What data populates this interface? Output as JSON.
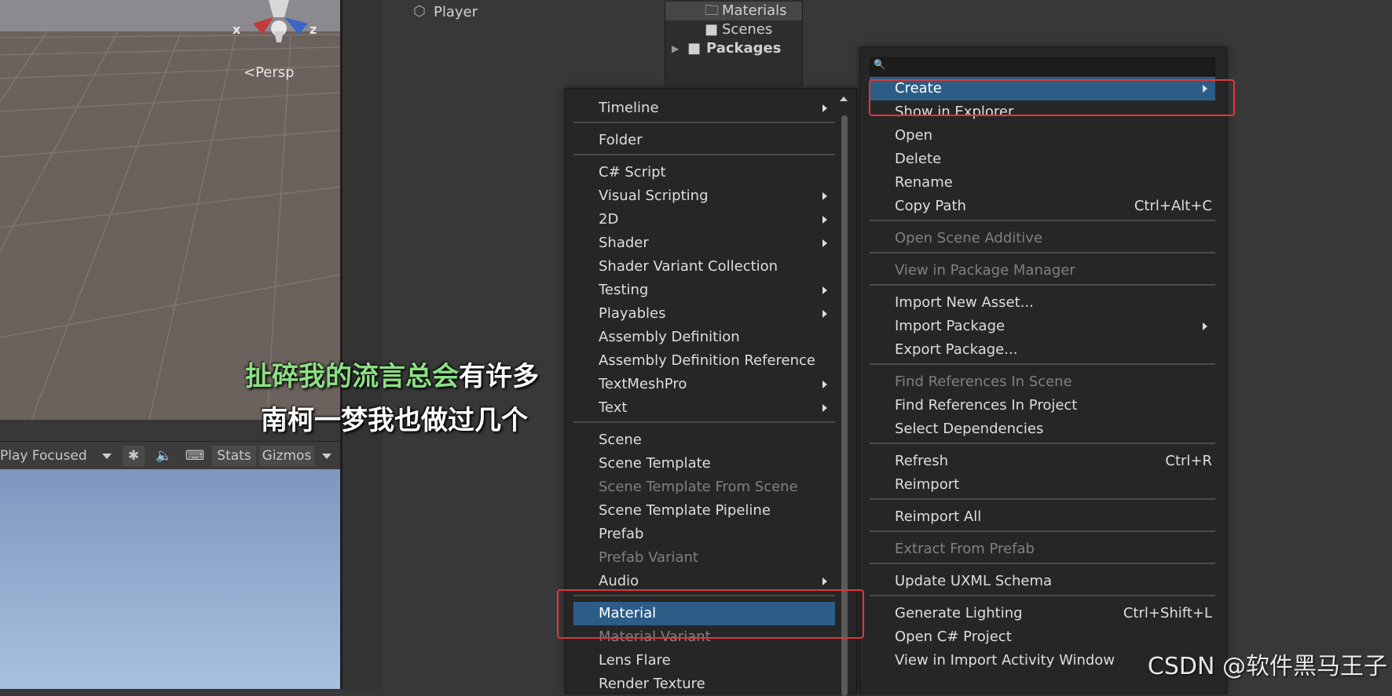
{
  "scene": {
    "axis_x": "x",
    "axis_z": "z",
    "persp_label": "<Persp",
    "hierarchy_item": "Player"
  },
  "game_toolbar": {
    "play_focused": "Play Focused",
    "stats": "Stats",
    "gizmos": "Gizmos"
  },
  "project_tree": {
    "materials": "Materials",
    "scenes": "Scenes",
    "packages": "Packages"
  },
  "create_menu": {
    "items": [
      {
        "label": "Timeline",
        "submenu": true
      },
      {
        "label": "Folder"
      },
      {
        "label": "C# Script"
      },
      {
        "label": "Visual Scripting",
        "submenu": true
      },
      {
        "label": "2D",
        "submenu": true
      },
      {
        "label": "Shader",
        "submenu": true
      },
      {
        "label": "Shader Variant Collection"
      },
      {
        "label": "Testing",
        "submenu": true
      },
      {
        "label": "Playables",
        "submenu": true
      },
      {
        "label": "Assembly Definition"
      },
      {
        "label": "Assembly Definition Reference"
      },
      {
        "label": "TextMeshPro",
        "submenu": true
      },
      {
        "label": "Text",
        "submenu": true
      },
      {
        "label": "Scene"
      },
      {
        "label": "Scene Template"
      },
      {
        "label": "Scene Template From Scene",
        "disabled": true
      },
      {
        "label": "Scene Template Pipeline"
      },
      {
        "label": "Prefab"
      },
      {
        "label": "Prefab Variant",
        "disabled": true
      },
      {
        "label": "Audio",
        "submenu": true
      },
      {
        "label": "Material",
        "selected": true
      },
      {
        "label": "Material Variant",
        "disabled": true
      },
      {
        "label": "Lens Flare"
      },
      {
        "label": "Render Texture"
      }
    ]
  },
  "context_menu": {
    "search_placeholder": "",
    "items": [
      {
        "label": "Create",
        "submenu": true,
        "selected": true
      },
      {
        "label": "Show in Explorer"
      },
      {
        "label": "Open"
      },
      {
        "label": "Delete"
      },
      {
        "label": "Rename"
      },
      {
        "label": "Copy Path",
        "shortcut": "Ctrl+Alt+C"
      },
      {
        "label": "Open Scene Additive",
        "disabled": true
      },
      {
        "label": "View in Package Manager",
        "disabled": true
      },
      {
        "label": "Import New Asset..."
      },
      {
        "label": "Import Package",
        "submenu": true
      },
      {
        "label": "Export Package..."
      },
      {
        "label": "Find References In Scene",
        "disabled": true
      },
      {
        "label": "Find References In Project"
      },
      {
        "label": "Select Dependencies"
      },
      {
        "label": "Refresh",
        "shortcut": "Ctrl+R"
      },
      {
        "label": "Reimport"
      },
      {
        "label": "Reimport All"
      },
      {
        "label": "Extract From Prefab",
        "disabled": true
      },
      {
        "label": "Update UXML Schema"
      },
      {
        "label": "Generate Lighting",
        "shortcut": "Ctrl+Shift+L"
      },
      {
        "label": "Open C# Project"
      },
      {
        "label": "View in Import Activity Window"
      }
    ]
  },
  "subtitle": {
    "line1_highlight": "扯碎我的流言总会",
    "line1_rest": "有许多",
    "line2": "南柯一梦我也做过几个"
  },
  "watermark": "CSDN @软件黑马王子",
  "colors": {
    "highlight": "#2c5d87",
    "annotation_box": "#e0373a",
    "subtitle_green": "#8be084"
  }
}
